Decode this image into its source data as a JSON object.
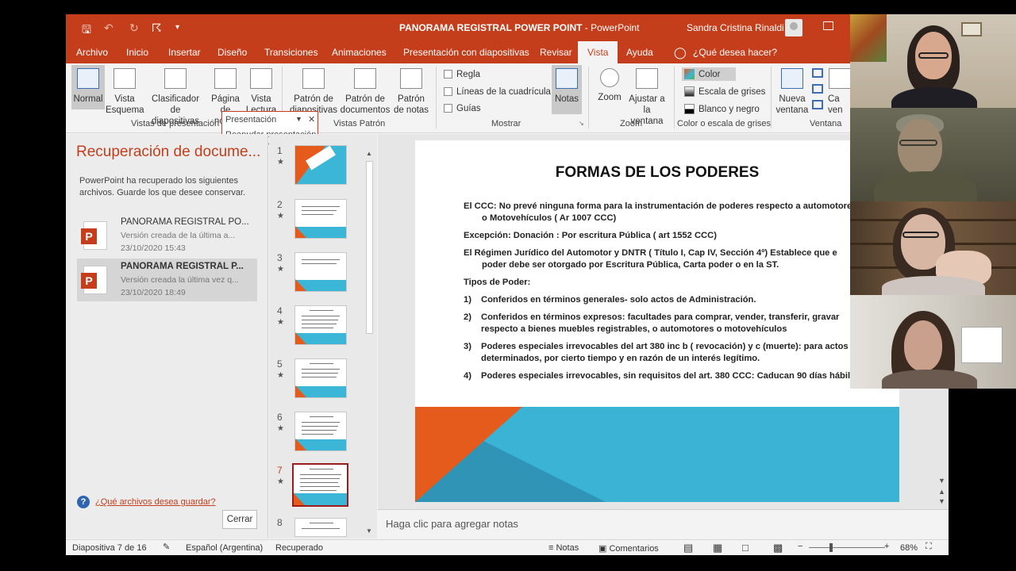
{
  "window": {
    "doc_title": "PANORAMA REGISTRAL POWER POINT",
    "separator": " - ",
    "app_name": "PowerPoint",
    "user_name": "Sandra  Cristina Rinaldi",
    "quick_access": [
      "save-icon",
      "undo-icon",
      "redo-icon",
      "present-icon",
      "customize-icon"
    ]
  },
  "tabs": [
    "Archivo",
    "Inicio",
    "Insertar",
    "Diseño",
    "Transiciones",
    "Animaciones",
    "Presentación con diapositivas",
    "Revisar",
    "Vista",
    "Ayuda",
    "¿Qué desea hacer?"
  ],
  "active_tab": "Vista",
  "ribbon": {
    "views": {
      "normal": "Normal",
      "outline": [
        "Vista",
        "Esquema"
      ],
      "sorter": [
        "Clasificador",
        "de diapositivas"
      ],
      "notes_page": [
        "Página",
        "de notas"
      ],
      "reading": [
        "Vista",
        "Lectura"
      ],
      "group": "Vistas de presentación"
    },
    "masters": {
      "slide": [
        "Patrón de",
        "diapositivas"
      ],
      "handout": [
        "Patrón de",
        "documentos"
      ],
      "notes": [
        "Patrón",
        "de notas"
      ],
      "group": "Vistas Patrón"
    },
    "show": {
      "ruler": "Regla",
      "gridlines": "Líneas de la cuadrícula",
      "guides": "Guías",
      "notes": "Notas",
      "group": "Mostrar"
    },
    "zoom": {
      "zoom": "Zoom",
      "fit": [
        "Ajustar a",
        "la ventana"
      ],
      "group": "Zoom"
    },
    "color": {
      "color": "Color",
      "grayscale": "Escala de grises",
      "bw": "Blanco y negro",
      "group": "Color o escala de grises",
      "swatch_color": "#e55b1c"
    },
    "window": {
      "new_window": [
        "Nueva",
        "ventana"
      ],
      "cascade": [
        "Ca",
        "ven"
      ],
      "group": "Ventana"
    }
  },
  "popup": {
    "title": "Presentación",
    "action": "Reanudar presentación"
  },
  "recovery": {
    "title": "Recuperación de docume...",
    "description": "PowerPoint ha recuperado los siguientes archivos. Guarde los que desee conservar.",
    "files": [
      {
        "name": "PANORAMA REGISTRAL PO...",
        "sub": "Versión creada de la última a...",
        "date": "23/10/2020 15:43"
      },
      {
        "name": "PANORAMA REGISTRAL P...",
        "sub": "Versión creada la última vez q...",
        "date": "23/10/2020 18:49"
      }
    ],
    "help": "¿Qué archivos desea guardar?",
    "close": "Cerrar"
  },
  "thumbnails": {
    "numbers": [
      "1",
      "2",
      "3",
      "4",
      "5",
      "6",
      "7",
      "8"
    ],
    "star": "★",
    "current": "7"
  },
  "slide": {
    "title": "FORMAS DE LOS PODERES",
    "lines": [
      "El CCC: No prevé ninguna forma para la instrumentación de poderes respecto a automotores",
      "o Motovehículos  ( Ar 1007 CCC)",
      "Excepción: Donación : Por escritura Pública ( art 1552 CCC)",
      "El Régimen Jurídico del Automotor y DNTR ( Título I, Cap IV, Sección 4º) Establece  que e",
      "poder debe ser otorgado por Escritura Pública, Carta poder o en la ST.",
      "Tipos de Poder:"
    ],
    "items": [
      {
        "num": "1)",
        "lines": [
          "Conferidos en términos generales- solo actos de Administración."
        ]
      },
      {
        "num": "2)",
        "lines": [
          "Conferidos en términos expresos: facultades para comprar, vender, transferir, gravar",
          "respecto a bienes muebles registrables, o automotores  o motovehículos"
        ]
      },
      {
        "num": "3)",
        "lines": [
          "Poderes especiales irrevocables del art 380 inc b ( revocación) y c (muerte): para actos",
          "determinados, por cierto tiempo y en razón de un interés legítimo."
        ]
      },
      {
        "num": "4)",
        "lines": [
          "Poderes especiales irrevocables, sin requisitos del art. 380 CCC: Caducan 90 días hábiles."
        ]
      }
    ],
    "notes_placeholder": "Haga clic para agregar notas"
  },
  "status": {
    "slide_counter": "Diapositiva 7 de 16",
    "language": "Español (Argentina)",
    "state": "Recuperado",
    "notes": "Notas",
    "comments": "Comentarios",
    "zoom": "68%"
  }
}
